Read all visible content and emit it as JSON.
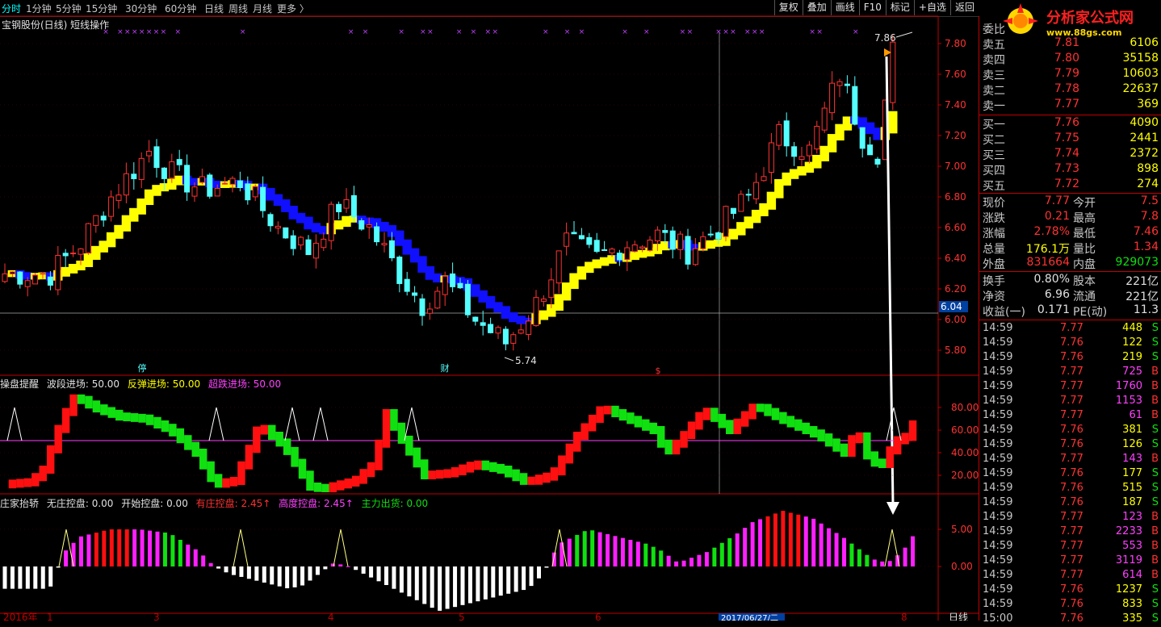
{
  "timeframe_tabs": [
    "分时",
    "1分钟",
    "5分钟",
    "15分钟",
    "30分钟",
    "60分钟",
    "日线",
    "周线",
    "月线",
    "更多 〉"
  ],
  "toolbar": [
    "复权",
    "叠加",
    "画线",
    "F10",
    "标记",
    "+自选",
    "返回"
  ],
  "stock_title": "宝钢股份(日线) 短线操作",
  "logo": {
    "name": "分析家公式网",
    "url": "www.88gs.com"
  },
  "main_axis": {
    "labels": [
      "7.80",
      "7.60",
      "7.40",
      "7.20",
      "7.00",
      "6.80",
      "6.60",
      "6.40",
      "6.20",
      "6.00",
      "5.80"
    ],
    "cross_label": "6.04",
    "low_label": "5.74",
    "high_label": "7.86"
  },
  "markers": {
    "ting": "停",
    "cai": "财",
    "dollar": "$"
  },
  "legend1": {
    "name": "操盘提醒",
    "items": [
      "波段进场: 50.00",
      "反弹进场: 50.00",
      "超跌进场: 50.00"
    ]
  },
  "axis2": [
    "80.00",
    "60.00",
    "40.00",
    "20.00"
  ],
  "legend2": {
    "name": "庄家抬轿",
    "items": [
      "无庄控盘: 0.00",
      "开始控盘: 0.00",
      "有庄控盘: 2.45↑",
      "高度控盘: 2.45↑",
      "主力出货: 0.00"
    ]
  },
  "axis3": [
    "5.00",
    "0.00"
  ],
  "date_axis": {
    "left": "2016年",
    "mid": "2017/06/27/二",
    "right": "日线",
    "ticks": [
      "1",
      "3",
      "4",
      "5",
      "6",
      "8",
      "9"
    ]
  },
  "colors": {
    "up": "#ff3232",
    "up_fill": "#000000",
    "down": "#54ffff",
    "yellow": "#ffff00",
    "blue": "#1010ff",
    "red": "#ff1010",
    "green": "#10e010",
    "magenta": "#ff20ff",
    "white": "#ffffff",
    "grid": "#c00000",
    "purple": "#c040ff"
  },
  "quotes": {
    "header": "委比",
    "asks": [
      {
        "label": "卖五",
        "price": "7.81",
        "vol": "6106"
      },
      {
        "label": "卖四",
        "price": "7.80",
        "vol": "35158"
      },
      {
        "label": "卖三",
        "price": "7.79",
        "vol": "10603"
      },
      {
        "label": "卖二",
        "price": "7.78",
        "vol": "22637"
      },
      {
        "label": "卖一",
        "price": "7.77",
        "vol": "369"
      }
    ],
    "bids": [
      {
        "label": "买一",
        "price": "7.76",
        "vol": "4090"
      },
      {
        "label": "买二",
        "price": "7.75",
        "vol": "2441"
      },
      {
        "label": "买三",
        "price": "7.74",
        "vol": "2372"
      },
      {
        "label": "买四",
        "price": "7.73",
        "vol": "898"
      },
      {
        "label": "买五",
        "price": "7.72",
        "vol": "274"
      }
    ]
  },
  "stats": [
    {
      "k1": "现价",
      "v1": "7.77",
      "c1": "#ff3232",
      "k2": "今开",
      "v2": "7.5",
      "c2": "#ff3232"
    },
    {
      "k1": "涨跌",
      "v1": "0.21",
      "c1": "#ff3232",
      "k2": "最高",
      "v2": "7.8",
      "c2": "#ff3232"
    },
    {
      "k1": "涨幅",
      "v1": "2.78%",
      "c1": "#ff3232",
      "k2": "最低",
      "v2": "7.46",
      "c2": "#ff3232"
    },
    {
      "k1": "总量",
      "v1": "176.1万",
      "c1": "#ffff00",
      "k2": "量比",
      "v2": "1.34",
      "c2": "#ff3232"
    },
    {
      "k1": "外盘",
      "v1": "831664",
      "c1": "#ff3232",
      "k2": "内盘",
      "v2": "929073",
      "c2": "#10e010"
    }
  ],
  "stats2": [
    {
      "k1": "换手",
      "v1": "0.80%",
      "k2": "股本",
      "v2": "221亿"
    },
    {
      "k1": "净资",
      "v1": "6.96",
      "k2": "流通",
      "v2": "221亿"
    },
    {
      "k1": "收益(一)",
      "v1": "0.171",
      "k2": "PE(动)",
      "v2": "11.3"
    }
  ],
  "ticks": [
    {
      "t": "14:59",
      "p": "7.77",
      "v": "448",
      "s": "S"
    },
    {
      "t": "14:59",
      "p": "7.76",
      "v": "122",
      "s": "S"
    },
    {
      "t": "14:59",
      "p": "7.76",
      "v": "219",
      "s": "S"
    },
    {
      "t": "14:59",
      "p": "7.77",
      "v": "725",
      "s": "B"
    },
    {
      "t": "14:59",
      "p": "7.77",
      "v": "1760",
      "s": "B"
    },
    {
      "t": "14:59",
      "p": "7.77",
      "v": "1153",
      "s": "B"
    },
    {
      "t": "14:59",
      "p": "7.77",
      "v": "61",
      "s": "B"
    },
    {
      "t": "14:59",
      "p": "7.76",
      "v": "381",
      "s": "S"
    },
    {
      "t": "14:59",
      "p": "7.76",
      "v": "126",
      "s": "S"
    },
    {
      "t": "14:59",
      "p": "7.77",
      "v": "143",
      "s": "B"
    },
    {
      "t": "14:59",
      "p": "7.76",
      "v": "177",
      "s": "S"
    },
    {
      "t": "14:59",
      "p": "7.76",
      "v": "515",
      "s": "S"
    },
    {
      "t": "14:59",
      "p": "7.76",
      "v": "187",
      "s": "S"
    },
    {
      "t": "14:59",
      "p": "7.77",
      "v": "123",
      "s": "B"
    },
    {
      "t": "14:59",
      "p": "7.77",
      "v": "2233",
      "s": "B"
    },
    {
      "t": "14:59",
      "p": "7.77",
      "v": "553",
      "s": "B"
    },
    {
      "t": "14:59",
      "p": "7.77",
      "v": "3119",
      "s": "B"
    },
    {
      "t": "14:59",
      "p": "7.77",
      "v": "614",
      "s": "B"
    },
    {
      "t": "14:59",
      "p": "7.76",
      "v": "1237",
      "s": "S"
    },
    {
      "t": "14:59",
      "p": "7.76",
      "v": "833",
      "s": "S"
    },
    {
      "t": "15:00",
      "p": "7.76",
      "v": "335",
      "s": "S"
    }
  ]
}
